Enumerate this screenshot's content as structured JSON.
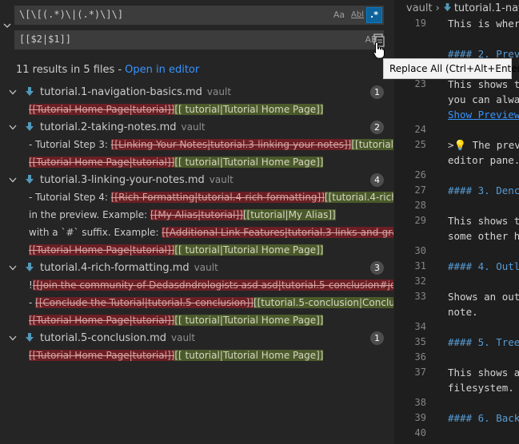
{
  "search": {
    "query": "\\[\\[(.*)\\|(.*)\\]\\]",
    "match_case_label": "Aa",
    "whole_word_label": "Abl",
    "regex_label": ".*"
  },
  "replace": {
    "value": "[[$2|$1]]",
    "preserve_case_label": "AB"
  },
  "tooltip": {
    "text": "Replace All (Ctrl+Alt+Enter)"
  },
  "results": {
    "summary": "11 results in 5 files -",
    "open_in_editor": "Open in editor"
  },
  "file_groups": [
    {
      "name": "tutorial.1-navigation-basics.md",
      "path": "vault",
      "count": "1",
      "matches": [
        {
          "prefix": "",
          "del": "[[Tutorial Home Page|tutorial]]",
          "ins": "[[ tutorial|Tutorial Home Page]]"
        }
      ]
    },
    {
      "name": "tutorial.2-taking-notes.md",
      "path": "vault",
      "count": "2",
      "matches": [
        {
          "prefix": "- Tutorial Step 3: ",
          "del": "[[Linking Your Notes|tutorial.3-linking-your-notes]]",
          "ins": "[[tutorial.3..."
        },
        {
          "prefix": "",
          "del": "[[Tutorial Home Page|tutorial]]",
          "ins": "[[ tutorial|Tutorial Home Page]]"
        }
      ]
    },
    {
      "name": "tutorial.3-linking-your-notes.md",
      "path": "vault",
      "count": "4",
      "matches": [
        {
          "prefix": "- Tutorial Step 4: ",
          "del": "[[Rich Formatting|tutorial.4-rich-formatting]]",
          "ins": "[[tutorial.4-rich-f..."
        },
        {
          "prefix": "in the preview. Example: ",
          "del": "[[My Alias|tutorial]]",
          "ins": "[[tutorial|My Alias]]"
        },
        {
          "prefix": "with a `#` suffix. Example: ",
          "del": "[[Additional Link Features|tutorial.3-links-and-graph...",
          "ins": ""
        },
        {
          "prefix": "",
          "del": "[[Tutorial Home Page|tutorial]]",
          "ins": "[[ tutorial|Tutorial Home Page]]"
        }
      ]
    },
    {
      "name": "tutorial.4-rich-formatting.md",
      "path": "vault",
      "count": "3",
      "matches": [
        {
          "prefix": "!",
          "del": "[[Join the community of Dedasdndrologists asd asd|tutorial.5-conclusion#joi...",
          "ins": ""
        },
        {
          "prefix": "- ",
          "del": "[[Conclude the Tutorial|tutorial.5-conclusion]]",
          "ins": "[[tutorial.5-conclusion|Conclud..."
        },
        {
          "prefix": "",
          "del": "[[Tutorial Home Page|tutorial]]",
          "ins": "[[ tutorial|Tutorial Home Page]]"
        }
      ]
    },
    {
      "name": "tutorial.5-conclusion.md",
      "path": "vault",
      "count": "1",
      "matches": [
        {
          "prefix": "",
          "del": "[[Tutorial Home Page|tutorial]]",
          "ins": "[[ tutorial|Tutorial Home Page]]"
        }
      ]
    }
  ],
  "editor": {
    "breadcrumb_root": "vault",
    "breadcrumb_file": "tutorial.1-nav",
    "lines": [
      {
        "num": "19",
        "text": "This is wher",
        "kind": "text"
      },
      {
        "num": "",
        "text": "",
        "kind": "text"
      },
      {
        "num": "",
        "text": "#### 2. Prev",
        "kind": "heading"
      },
      {
        "num": "",
        "text": "",
        "kind": "text"
      },
      {
        "num": "23",
        "text": "This shows t",
        "kind": "text"
      },
      {
        "num": "",
        "text": "you can alwa",
        "kind": "text"
      },
      {
        "num": "",
        "text": "Show Preview",
        "kind": "link"
      },
      {
        "num": "24",
        "text": "",
        "kind": "text"
      },
      {
        "num": "25",
        "text": ">💡 The prev",
        "kind": "text"
      },
      {
        "num": "",
        "text": "editor pane.",
        "kind": "text"
      },
      {
        "num": "26",
        "text": "",
        "kind": "text"
      },
      {
        "num": "27",
        "text": "#### 3. Denc",
        "kind": "heading"
      },
      {
        "num": "28",
        "text": "",
        "kind": "text"
      },
      {
        "num": "29",
        "text": "This shows t",
        "kind": "text"
      },
      {
        "num": "",
        "text": "some other h",
        "kind": "text"
      },
      {
        "num": "30",
        "text": "",
        "kind": "text"
      },
      {
        "num": "31",
        "text": "#### 4. Outl",
        "kind": "heading"
      },
      {
        "num": "32",
        "text": "",
        "kind": "text"
      },
      {
        "num": "33",
        "text": "Shows an out",
        "kind": "text"
      },
      {
        "num": "",
        "text": "note.",
        "kind": "text"
      },
      {
        "num": "34",
        "text": "",
        "kind": "text"
      },
      {
        "num": "35",
        "text": "#### 5. Tree",
        "kind": "heading"
      },
      {
        "num": "36",
        "text": "",
        "kind": "text"
      },
      {
        "num": "37",
        "text": "This shows a",
        "kind": "text"
      },
      {
        "num": "",
        "text": "filesystem.",
        "kind": "text"
      },
      {
        "num": "38",
        "text": "",
        "kind": "text"
      },
      {
        "num": "39",
        "text": "#### 6. Back",
        "kind": "heading"
      },
      {
        "num": "40",
        "text": "",
        "kind": "text"
      }
    ]
  },
  "colors": {
    "sidebar_bg": "#252526",
    "editor_bg": "#1e1e1e",
    "deleted_bg": "#6b1f24",
    "inserted_bg": "#4b5a2a",
    "link": "#3794ff",
    "markdown_file_icon": "#519aba"
  }
}
